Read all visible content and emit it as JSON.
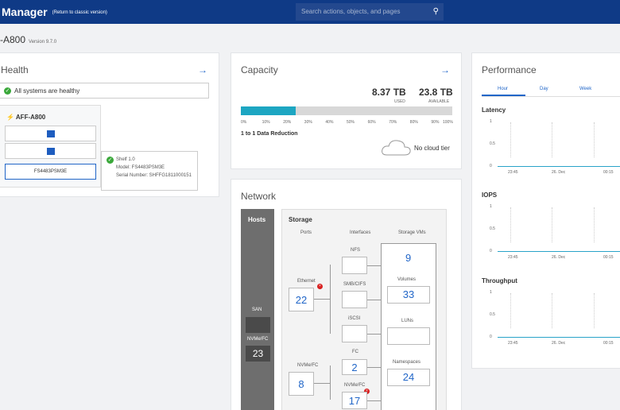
{
  "header": {
    "title": "Manager",
    "classic_link": "(Return to classic version)",
    "search_placeholder": "Search actions, objects, and pages"
  },
  "cluster": {
    "name": "-A800",
    "version": "Version 9.7.0"
  },
  "health": {
    "title": "Health",
    "status": "All systems are healthy",
    "device_name": "AFF-A800",
    "shelf_id": "FS4483PSM3E",
    "tooltip": {
      "title": "Shelf 1.0",
      "model": "Model: FS4483PSM3E",
      "serial": "Serial Number: SHFFG1811000151"
    }
  },
  "capacity": {
    "title": "Capacity",
    "used_value": "8.37 TB",
    "used_label": "USED",
    "available_value": "23.8 TB",
    "available_label": "AVAILABLE",
    "used_fraction": 0.26,
    "ticks": [
      "0%",
      "10%",
      "20%",
      "30%",
      "40%",
      "50%",
      "60%",
      "70%",
      "80%",
      "90%",
      "100%"
    ],
    "reduction": "1 to 1 Data Reduction",
    "cloud_tier": "No cloud tier"
  },
  "network": {
    "title": "Network",
    "hosts_label": "Hosts",
    "storage_label": "Storage",
    "col_ports": "Ports",
    "col_interfaces": "Interfaces",
    "col_svms": "Storage VMs",
    "san_label": "SAN",
    "nvme_fc_host_label": "NVMe/FC",
    "nvme_fc_host_value": "23",
    "ethernet_label": "Ethernet",
    "ethernet_value": "22",
    "nvmefc_port_label": "NVMe/FC",
    "nvmefc_port_value": "8",
    "nfs": "NFS",
    "smb": "SMB/CIFS",
    "iscsi": "iSCSI",
    "fc_label": "FC",
    "fc_value": "2",
    "nvmefc_if_label": "NVMe/FC",
    "nvmefc_if_value": "17",
    "svm_value": "9",
    "volumes_label": "Volumes",
    "volumes_value": "33",
    "luns_label": "LUNs",
    "namespaces_label": "Namespaces",
    "namespaces_value": "24"
  },
  "performance": {
    "title": "Performance",
    "tabs": [
      "Hour",
      "Day",
      "Week"
    ],
    "charts": [
      {
        "title": "Latency",
        "y_ticks": [
          "1",
          "0.5",
          "0"
        ]
      },
      {
        "title": "IOPS",
        "y_ticks": [
          "1",
          "0.5",
          "0"
        ]
      },
      {
        "title": "Throughput",
        "y_ticks": [
          "1",
          "0.5",
          "0"
        ]
      }
    ],
    "x_ticks": [
      "23:45",
      "26. Dec",
      "00:15"
    ]
  },
  "colors": {
    "topbar": "#0f3a86",
    "accent": "#2166c8",
    "capacity_fill": "#1da6c2",
    "healthy": "#3aa83a",
    "error": "#d82020"
  }
}
